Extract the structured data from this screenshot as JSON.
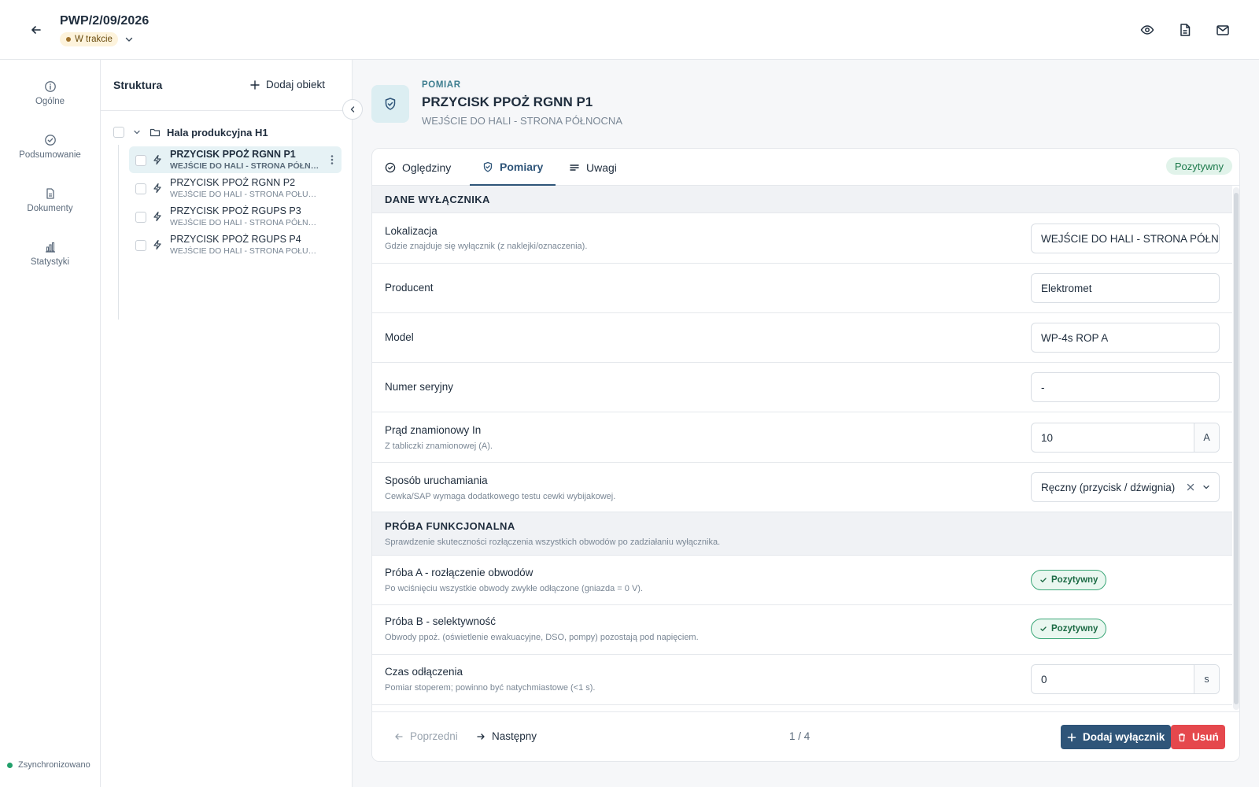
{
  "header": {
    "title": "PWP/2/09/2026",
    "status": "W trakcie",
    "icons": [
      "arrow-left-icon",
      "chevron-down-icon",
      "eye-icon",
      "document-icon",
      "mail-icon"
    ]
  },
  "leftnav": {
    "items": [
      {
        "label": "Ogólne",
        "icon": "info-icon"
      },
      {
        "label": "Podsumowanie",
        "icon": "check-circle-icon"
      },
      {
        "label": "Dokumenty",
        "icon": "document-icon"
      },
      {
        "label": "Statystyki",
        "icon": "bar-chart-icon"
      }
    ],
    "sync_status": "Zsynchronizowano"
  },
  "tree": {
    "title": "Struktura",
    "add_label": "Dodaj obiekt",
    "group": "Hala produkcyjna H1",
    "items": [
      {
        "name": "PRZYCISK PPOŻ RGNN P1",
        "sub": "WEJŚCIE DO HALI - STRONA PÓŁNOCNA",
        "active": true
      },
      {
        "name": "PRZYCISK PPOŻ RGNN P2",
        "sub": "WEJŚCIE DO HALI - STRONA POŁUDNIOWA",
        "active": false
      },
      {
        "name": "PRZYCISK PPOŻ RGUPS P3",
        "sub": "WEJŚCIE DO HALI - STRONA PÓŁNOCNA",
        "active": false
      },
      {
        "name": "PRZYCISK PPOŻ RGUPS P4",
        "sub": "WEJŚCIE DO HALI - STRONA POŁUDNIOWA",
        "active": false
      }
    ]
  },
  "main": {
    "kicker": "POMIAR",
    "title": "PRZYCISK PPOŻ RGNN P1",
    "subtitle": "WEJŚCIE DO HALI - STRONA PÓŁNOCNA",
    "tabs": [
      {
        "label": "Oględziny",
        "icon": "check-circle-icon"
      },
      {
        "label": "Pomiary",
        "icon": "shield-check-icon"
      },
      {
        "label": "Uwagi",
        "icon": "lines-icon"
      }
    ],
    "result": "Pozytywny",
    "section1": {
      "title": "DANE WYŁĄCZNIKA"
    },
    "fields": {
      "lokalizacja": {
        "label": "Lokalizacja",
        "desc": "Gdzie znajduje się wyłącznik (z naklejki/oznaczenia).",
        "value": "WEJŚCIE DO HALI - STRONA PÓŁNOCNA"
      },
      "producent": {
        "label": "Producent",
        "value": "Elektromet"
      },
      "model": {
        "label": "Model",
        "value": "WP-4s ROP A"
      },
      "numer": {
        "label": "Numer seryjny",
        "value": "-"
      },
      "prad": {
        "label": "Prąd znamionowy In",
        "desc": "Z tabliczki znamionowej (A).",
        "value": "10",
        "unit": "A"
      },
      "sposob": {
        "label": "Sposób uruchamiania",
        "desc": "Cewka/SAP wymaga dodatkowego testu cewki wybijakowej.",
        "value": "Ręczny (przycisk / dźwignia)"
      }
    },
    "section2": {
      "title": "PRÓBA FUNKCJONALNA",
      "desc": "Sprawdzenie skuteczności rozłączenia wszystkich obwodów po zadziałaniu wyłącznika."
    },
    "tests": {
      "a": {
        "label": "Próba A - rozłączenie obwodów",
        "desc": "Po wciśnięciu wszystkie obwody zwykłe odłączone (gniazda = 0 V).",
        "result": "Pozytywny"
      },
      "b": {
        "label": "Próba B - selektywność",
        "desc": "Obwody ppoż. (oświetlenie ewakuacyjne, DSO, pompy) pozostają pod napięciem.",
        "result": "Pozytywny"
      },
      "czas": {
        "label": "Czas odłączenia",
        "desc": "Pomiar stoperem; powinno być natychmiastowe (<1 s).",
        "value": "0",
        "unit": "s"
      }
    },
    "footer": {
      "prev": "Poprzedni",
      "next": "Następny",
      "page": "1 / 4",
      "add": "Dodaj wyłącznik",
      "delete": "Usuń"
    }
  },
  "colors": {
    "accent": "#2f5579",
    "teal": "#3d7d8f",
    "positive": "#1d7a4c",
    "danger": "#e5484d",
    "status_bg": "#fdf3dc"
  }
}
